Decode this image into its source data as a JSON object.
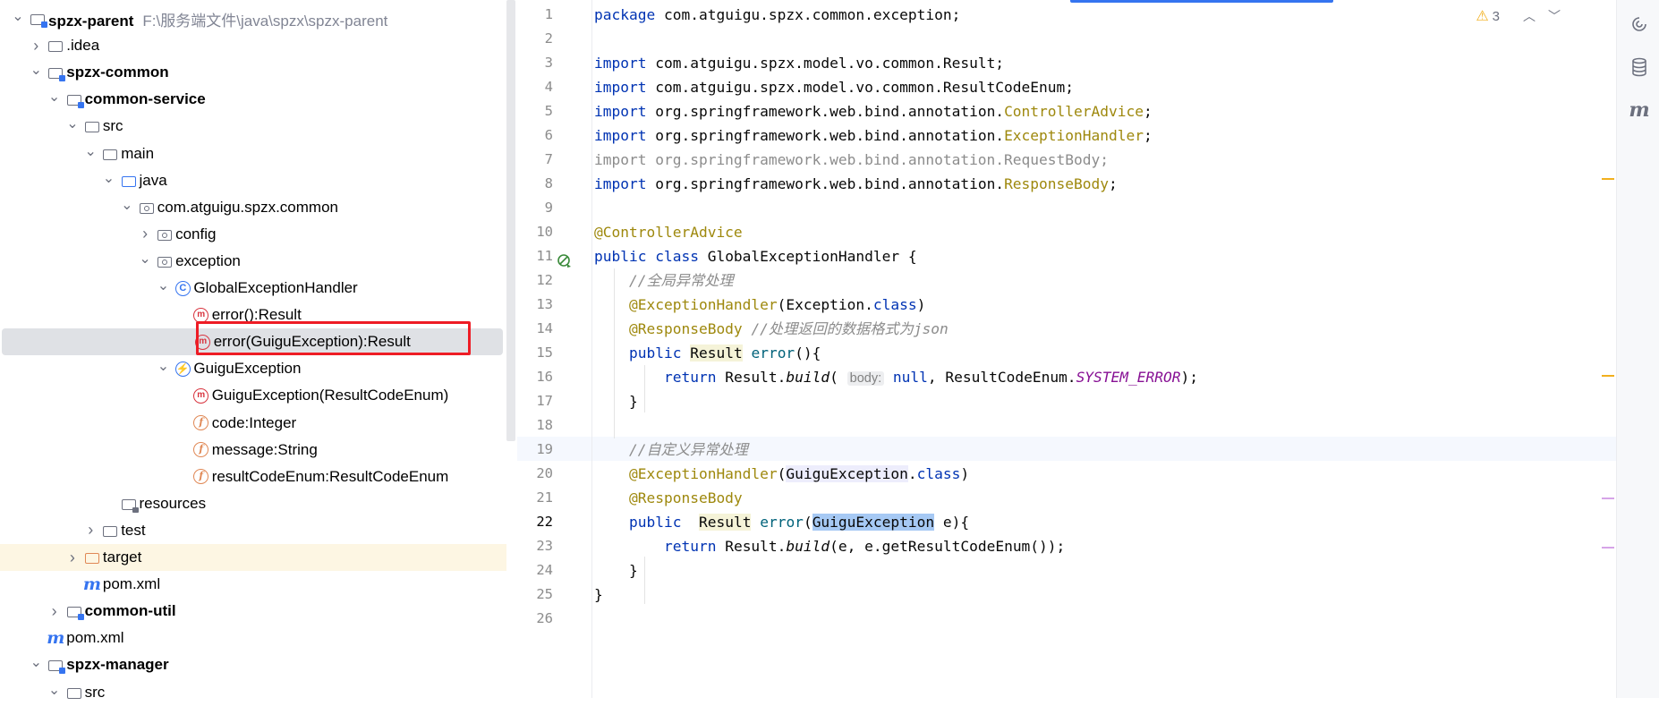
{
  "project_tree": {
    "rows": [
      {
        "label": "spzx-parent",
        "path": "F:\\服务端文件\\java\\spzx\\spzx-parent",
        "bold": true,
        "icon": "module-folder-icon",
        "chev": "down"
      },
      {
        "label": ".idea",
        "icon": "folder-icon",
        "chev": "right"
      },
      {
        "label": "spzx-common",
        "bold": true,
        "icon": "module-folder-icon",
        "chev": "down"
      },
      {
        "label": "common-service",
        "bold": true,
        "icon": "module-folder-icon",
        "chev": "down"
      },
      {
        "label": "src",
        "icon": "folder-icon",
        "chev": "down"
      },
      {
        "label": "main",
        "icon": "folder-icon",
        "chev": "down"
      },
      {
        "label": "java",
        "icon": "source-folder-icon",
        "chev": "down"
      },
      {
        "label": "com.atguigu.spzx.common",
        "icon": "package-icon",
        "chev": "down"
      },
      {
        "label": "config",
        "icon": "package-icon",
        "chev": "right"
      },
      {
        "label": "exception",
        "icon": "package-icon",
        "chev": "down"
      },
      {
        "label": "GlobalExceptionHandler",
        "icon": "class-icon",
        "chev": "down"
      },
      {
        "label": "error():Result",
        "icon": "method-icon"
      },
      {
        "label": "error(GuiguException):Result",
        "icon": "method-icon",
        "selected": true
      },
      {
        "label": "GuiguException",
        "icon": "exception-class-icon",
        "chev": "down"
      },
      {
        "label": "GuiguException(ResultCodeEnum)",
        "icon": "method-icon"
      },
      {
        "label": "code:Integer",
        "icon": "field-icon"
      },
      {
        "label": "message:String",
        "icon": "field-icon"
      },
      {
        "label": "resultCodeEnum:ResultCodeEnum",
        "icon": "field-icon"
      },
      {
        "label": "resources",
        "icon": "resources-folder-icon"
      },
      {
        "label": "test",
        "icon": "folder-icon",
        "chev": "right"
      },
      {
        "label": "target",
        "icon": "excluded-folder-icon",
        "chev": "right",
        "highlight": true
      },
      {
        "label": "pom.xml",
        "icon": "maven-icon"
      },
      {
        "label": "common-util",
        "bold": true,
        "icon": "module-folder-icon",
        "chev": "right"
      },
      {
        "label": "pom.xml",
        "icon": "maven-icon"
      },
      {
        "label": "spzx-manager",
        "bold": true,
        "icon": "module-folder-icon",
        "chev": "down"
      },
      {
        "label": "src",
        "icon": "folder-icon",
        "chev": "down"
      }
    ]
  },
  "editor": {
    "line_numbers": [
      "1",
      "2",
      "3",
      "4",
      "5",
      "6",
      "7",
      "8",
      "9",
      "10",
      "11",
      "12",
      "13",
      "14",
      "15",
      "16",
      "17",
      "18",
      "19",
      "20",
      "21",
      "22",
      "23",
      "24",
      "25",
      "26"
    ],
    "current_line": "22",
    "inspections": {
      "warning_count": "3"
    },
    "code": {
      "l1_kw": "package",
      "l1_rest": " com.atguigu.spzx.common.exception;",
      "import_kw": "import",
      "l3": " com.atguigu.spzx.model.vo.common.Result;",
      "l4": " com.atguigu.spzx.model.vo.common.ResultCodeEnum;",
      "l5_pre": " org.springframework.web.bind.annotation.",
      "l5_ann": "ControllerAdvice",
      "l6_ann": "ExceptionHandler",
      "l7": "import org.springframework.web.bind.annotation.RequestBody;",
      "l8_ann": "ResponseBody",
      "semi": ";",
      "l10": "@ControllerAdvice",
      "l11_kw": "public class",
      "l11_rest": " GlobalExceptionHandler {",
      "l12": "//全局异常处理",
      "l13_ann": "@ExceptionHandler",
      "l13_rest": "(Exception.",
      "class_kw": "class",
      "close_paren": ")",
      "l14_ann": "@ResponseBody",
      "l14_cm": "//处理返回的数据格式为json",
      "public_kw": "public",
      "result_type": "Result",
      "error_name": "error",
      "l15_rest": "(){",
      "return_kw": "return",
      "result_build_pre": " Result.",
      "build": "build",
      "l16_open": "(",
      "l16_hint": "body:",
      "null_kw": "null",
      "l16_mid": ", ResultCodeEnum.",
      "l16_const": "SYSTEM_ERROR",
      "l16_end": ");",
      "close_brace": "}",
      "l19": "//自定义异常处理",
      "l20_type": "GuiguException",
      "l22_param_type": "GuiguException",
      "l22_rest": " e){",
      "l23_args": "(e, e.getResultCodeEnum());"
    }
  },
  "right_strip": {
    "icons": [
      "ai-assistant-icon",
      "database-icon",
      "maven-icon"
    ],
    "maven_letter": "m"
  }
}
